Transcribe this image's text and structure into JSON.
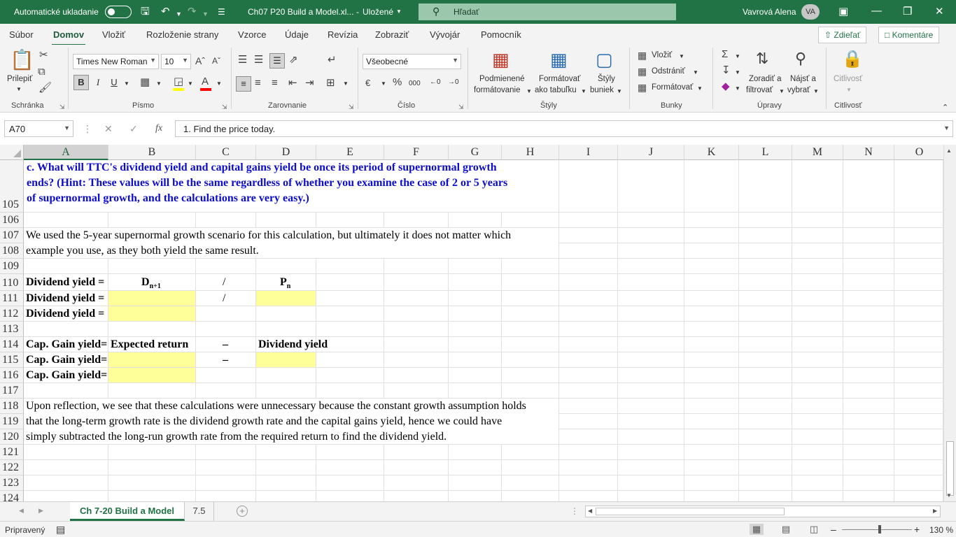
{
  "titlebar": {
    "autosave_label": "Automatické ukladanie",
    "doc_title": "Ch07 P20 Build a Model.xl...",
    "save_state": "Uložené",
    "search_placeholder": "Hľadať",
    "user_name": "Vavrová Alena",
    "user_initials": "VA"
  },
  "ribbon_tabs": [
    "Súbor",
    "Domov",
    "Vložiť",
    "Rozloženie strany",
    "Vzorce",
    "Údaje",
    "Revízia",
    "Zobraziť",
    "Vývojár",
    "Pomocník"
  ],
  "share_label": "Zdieľať",
  "comments_label": "Komentáre",
  "ribbon": {
    "clipboard": {
      "paste": "Prilepiť",
      "group": "Schránka"
    },
    "font": {
      "name": "Times New Roman",
      "size": "10",
      "bold": "B",
      "italic": "I",
      "underline": "U",
      "group": "Písmo"
    },
    "alignment": {
      "group": "Zarovnanie"
    },
    "number": {
      "format": "Všeobecné",
      "group": "Číslo"
    },
    "styles": {
      "conditional_1": "Podmienené",
      "conditional_2": "formátovanie",
      "table_1": "Formátovať",
      "table_2": "ako tabuľku",
      "cell_1": "Štýly",
      "cell_2": "buniek",
      "group": "Štýly"
    },
    "cells": {
      "insert": "Vložiť",
      "delete": "Odstrániť",
      "format": "Formátovať",
      "group": "Bunky"
    },
    "editing": {
      "sort_1": "Zoradiť a",
      "sort_2": "filtrovať",
      "find_1": "Nájsť a",
      "find_2": "vybrať",
      "group": "Úpravy"
    },
    "sensitivity": {
      "label": "Citlivosť",
      "group": "Citlivosť"
    }
  },
  "formula_bar": {
    "name_box": "A70",
    "formula": "1. Find the price today."
  },
  "columns": [
    "A",
    "B",
    "C",
    "D",
    "E",
    "F",
    "G",
    "H",
    "I",
    "J",
    "K",
    "L",
    "M",
    "N",
    "O"
  ],
  "rows": [
    "105",
    "106",
    "107",
    "108",
    "109",
    "110",
    "111",
    "112",
    "113",
    "114",
    "115",
    "116",
    "117",
    "118",
    "119",
    "120",
    "121",
    "122",
    "123",
    "124"
  ],
  "cells": {
    "q_line1": "c.  What will TTC's dividend yield and capital gains yield be once its period of supernormal growth",
    "q_line2": "ends?  (Hint:  These values will be the same regardless of whether you examine the case of 2 or 5 years",
    "q_line3": "of supernormal growth, and the calculations are very easy.)",
    "r107": "We used the 5-year supernormal growth scenario for this calculation, but ultimately it does not matter which",
    "r108": "example you use, as they both yield the same result.",
    "r110_a": "Dividend yield =",
    "r110_b_main": "D",
    "r110_b_sub": "n+1",
    "r110_c": "/",
    "r110_d_main": "P",
    "r110_d_sub": "n",
    "r111_a": "Dividend yield =",
    "r111_c": "/",
    "r112_a": "Dividend yield =",
    "r114_a": "Cap. Gain yield=",
    "r114_b": "Expected return",
    "r114_c": "–",
    "r114_d": "Dividend yield",
    "r115_a": "Cap. Gain yield=",
    "r115_c": "–",
    "r116_a": "Cap. Gain yield=",
    "r118": "Upon reflection, we see that these calculations were unnecessary because the constant growth assumption holds",
    "r119": "that the long-term growth rate is the dividend growth rate and the capital gains yield, hence we could have",
    "r120": "simply subtracted the long-run growth rate from the required return to find the dividend yield."
  },
  "sheet_tabs": [
    "Ch 7-20 Build a Model",
    "7.5"
  ],
  "status": {
    "ready": "Pripravený",
    "zoom": "130 %"
  },
  "colors": {
    "accent": "#217346",
    "input_fill": "#ffff99",
    "question_text": "#0d0dcc"
  }
}
